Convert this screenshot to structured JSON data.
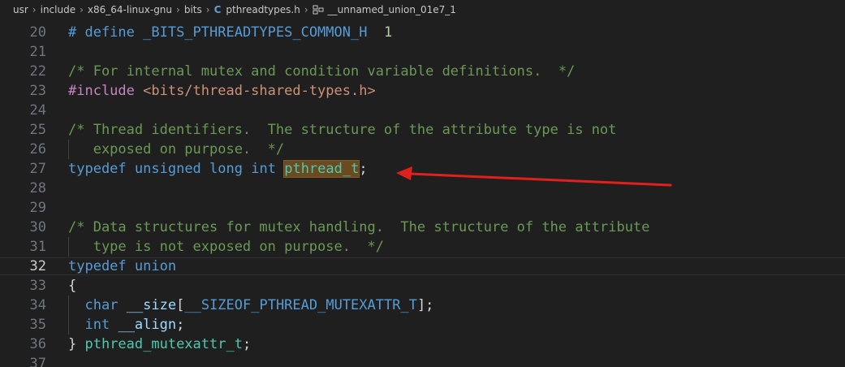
{
  "breadcrumb": {
    "items": [
      "usr",
      "include",
      "x86_64-linux-gnu",
      "bits",
      "pthreadtypes.h",
      "__unnamed_union_01e7_1"
    ],
    "file_icon": "C"
  },
  "editor": {
    "active_line": "32",
    "lines": [
      {
        "n": "20",
        "t": [
          [
            "mac",
            "# define "
          ],
          [
            "mac",
            "_BITS_PTHREADTYPES_COMMON_H"
          ],
          [
            "pl",
            "  "
          ],
          [
            "num",
            "1"
          ]
        ]
      },
      {
        "n": "21",
        "t": []
      },
      {
        "n": "22",
        "t": [
          [
            "cm",
            "/* For internal mutex and condition variable definitions.  */"
          ]
        ]
      },
      {
        "n": "23",
        "t": [
          [
            "pp",
            "#include "
          ],
          [
            "str",
            "<bits/thread-shared-types.h>"
          ]
        ]
      },
      {
        "n": "24",
        "t": []
      },
      {
        "n": "25",
        "t": [
          [
            "cm",
            "/* Thread identifiers.  The structure of the attribute type is not"
          ]
        ]
      },
      {
        "n": "26",
        "t": [
          [
            "cm",
            "   exposed on purpose.  */"
          ]
        ]
      },
      {
        "n": "27",
        "t": [
          [
            "kw",
            "typedef"
          ],
          [
            "pl",
            " "
          ],
          [
            "kw",
            "unsigned"
          ],
          [
            "pl",
            " "
          ],
          [
            "kw",
            "long"
          ],
          [
            "pl",
            " "
          ],
          [
            "kw",
            "int"
          ],
          [
            "pl",
            " "
          ],
          [
            "tyhl",
            "pthread_t"
          ],
          [
            "pl",
            ";"
          ]
        ]
      },
      {
        "n": "28",
        "t": []
      },
      {
        "n": "29",
        "t": []
      },
      {
        "n": "30",
        "t": [
          [
            "cm",
            "/* Data structures for mutex handling.  The structure of the attribute"
          ]
        ]
      },
      {
        "n": "31",
        "t": [
          [
            "cm",
            "   type is not exposed on purpose.  */"
          ]
        ]
      },
      {
        "n": "32",
        "t": [
          [
            "kw",
            "typedef"
          ],
          [
            "pl",
            " "
          ],
          [
            "kw",
            "union"
          ]
        ]
      },
      {
        "n": "33",
        "t": [
          [
            "pl",
            "{"
          ]
        ]
      },
      {
        "n": "34",
        "t": [
          [
            "pl",
            "  "
          ],
          [
            "kw",
            "char"
          ],
          [
            "pl",
            " "
          ],
          [
            "id",
            "__size"
          ],
          [
            "pl",
            "["
          ],
          [
            "mac",
            "__SIZEOF_PTHREAD_MUTEXATTR_T"
          ],
          [
            "pl",
            "];"
          ]
        ]
      },
      {
        "n": "35",
        "t": [
          [
            "pl",
            "  "
          ],
          [
            "kw",
            "int"
          ],
          [
            "pl",
            " "
          ],
          [
            "id",
            "__align"
          ],
          [
            "pl",
            ";"
          ]
        ]
      },
      {
        "n": "36",
        "t": [
          [
            "pl",
            "} "
          ],
          [
            "ty",
            "pthread_mutexattr_t"
          ],
          [
            "pl",
            ";"
          ]
        ]
      },
      {
        "n": "37",
        "t": []
      }
    ]
  },
  "colors": {
    "arrow": "#e0201c",
    "background": "#1f1f1f"
  }
}
